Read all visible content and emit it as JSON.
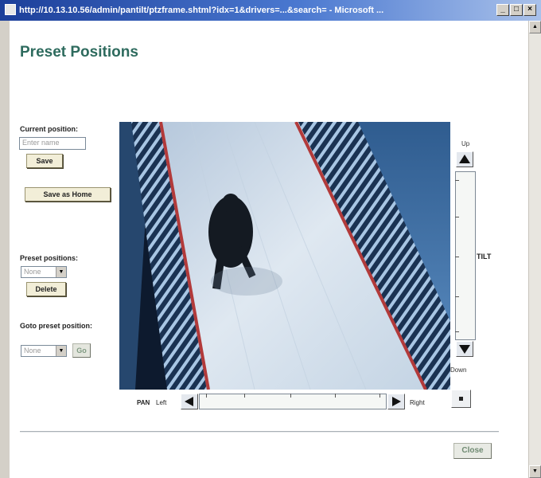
{
  "window": {
    "title": "http://10.13.10.56/admin/pantilt/ptzframe.shtml?idx=1&drivers=...&search= - Microsoft ...",
    "buttons": {
      "minimize": "_",
      "maximize": "□",
      "close": "×"
    }
  },
  "page": {
    "title": "Preset Positions"
  },
  "current_position": {
    "label": "Current position:",
    "input_placeholder": "Enter name",
    "save_label": "Save",
    "save_home_label": "Save as Home"
  },
  "preset_positions": {
    "label": "Preset positions:",
    "selected": "None",
    "delete_label": "Delete"
  },
  "goto_preset": {
    "label": "Goto preset position:",
    "selected": "None",
    "go_label": "Go"
  },
  "tilt": {
    "label": "TILT",
    "up_label": "Up",
    "down_label": "Down"
  },
  "pan": {
    "label": "PAN",
    "left_label": "Left",
    "right_label": "Right"
  },
  "footer": {
    "close_label": "Close"
  },
  "colors": {
    "title_green": "#2e6b5e",
    "button_bg": "#f2eed8",
    "titlebar": "#1c3f9a"
  },
  "icons": [
    "browser-icon",
    "up-arrow-icon",
    "down-arrow-icon",
    "left-arrow-icon",
    "right-arrow-icon",
    "center-icon"
  ]
}
